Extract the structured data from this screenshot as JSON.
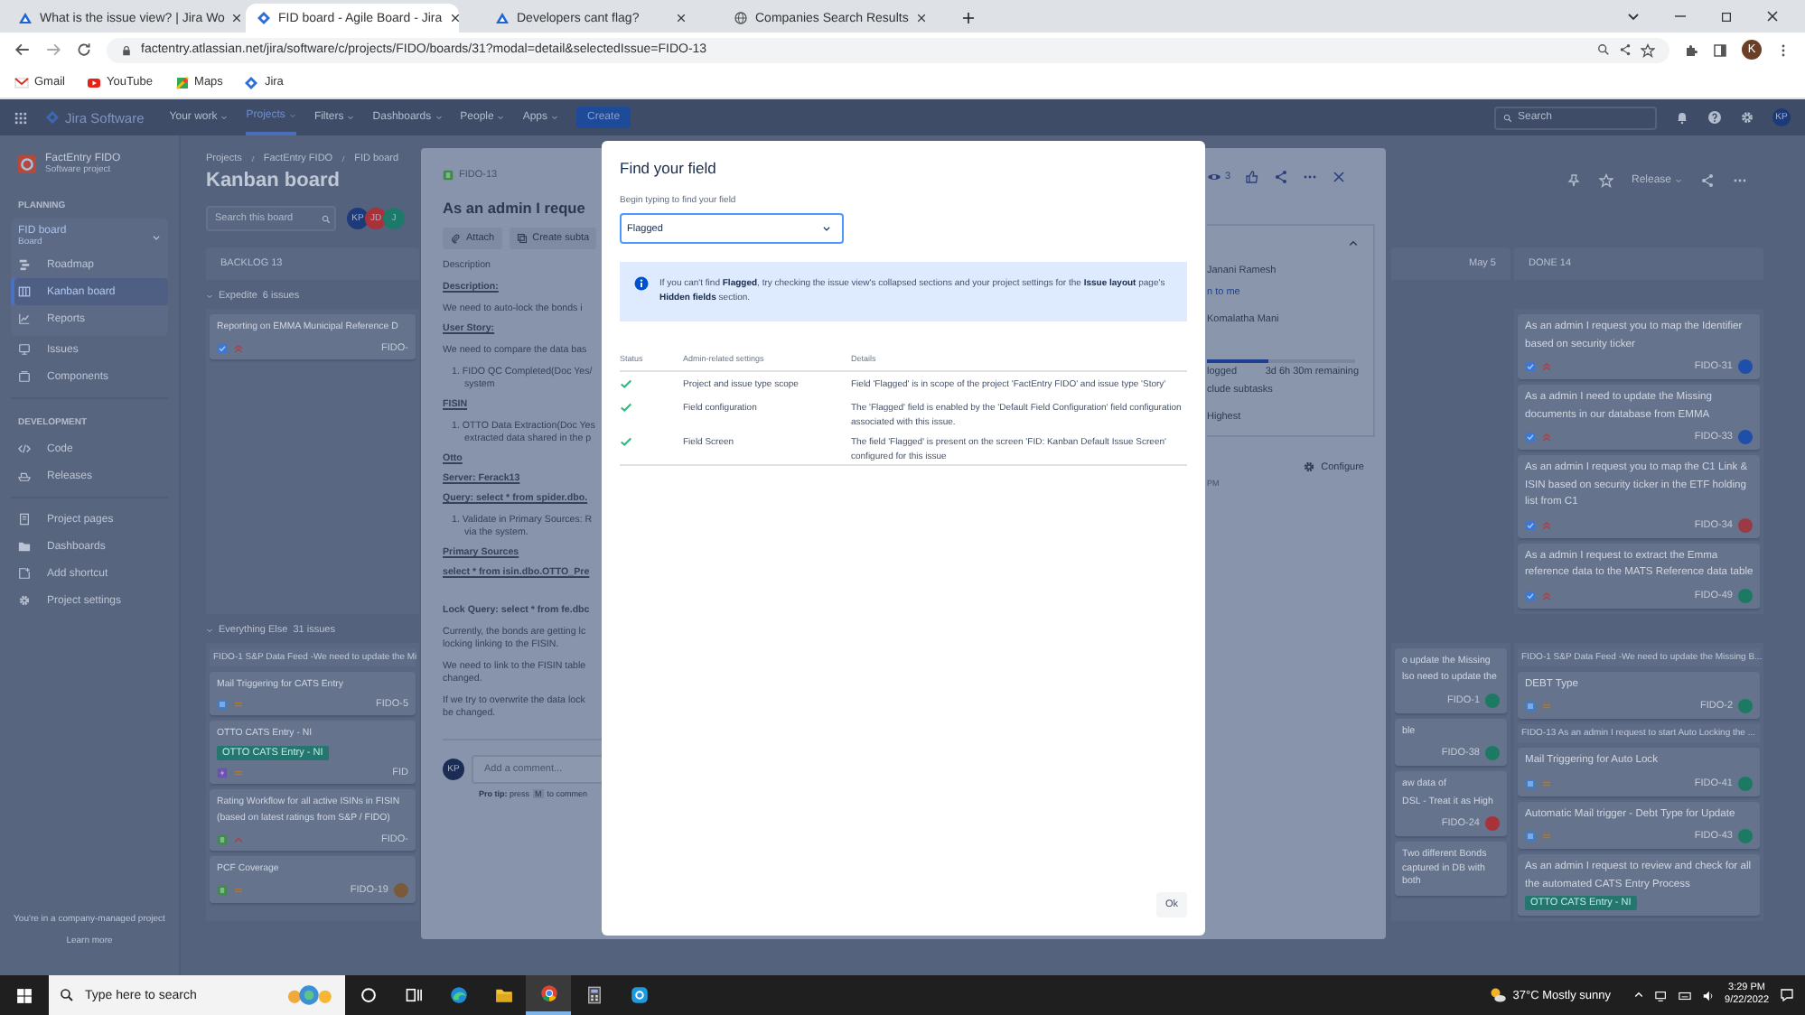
{
  "browser": {
    "tabs": [
      {
        "title": "What is the issue view? | Jira Wo",
        "kind": "triangle",
        "selected": false
      },
      {
        "title": "FID board - Agile Board - Jira",
        "kind": "diamond",
        "selected": true
      },
      {
        "title": "Developers cant flag?",
        "kind": "triangle",
        "selected": false
      },
      {
        "title": "Companies Search Results",
        "kind": "globe",
        "selected": false
      }
    ],
    "url": "factentry.atlassian.net/jira/software/c/projects/FIDO/boards/31?modal=detail&selectedIssue=FIDO-13",
    "profile": "K",
    "bookmarks": [
      {
        "label": "Gmail",
        "kind": "mail"
      },
      {
        "label": "YouTube",
        "kind": "play"
      },
      {
        "label": "Maps",
        "kind": "pin"
      },
      {
        "label": "Jira",
        "kind": "diamond"
      }
    ]
  },
  "jira_nav": {
    "product": "Jira Software",
    "items": [
      {
        "label": "Your work",
        "selected": false
      },
      {
        "label": "Projects",
        "selected": true
      },
      {
        "label": "Filters",
        "selected": false
      },
      {
        "label": "Dashboards",
        "selected": false
      },
      {
        "label": "People",
        "selected": false
      },
      {
        "label": "Apps",
        "selected": false
      }
    ],
    "create": "Create",
    "search": {
      "placeholder": "Search"
    },
    "avatar": "KP"
  },
  "sidebar": {
    "project": {
      "name": "FactEntry FIDO",
      "type": "Software project"
    },
    "groups": [
      {
        "heading": "PLANNING",
        "board": {
          "name": "FID board",
          "type": "Board"
        },
        "items": [
          {
            "label": "Roadmap",
            "kind": "roadmap",
            "selected": false
          },
          {
            "label": "Kanban board",
            "kind": "kanban",
            "selected": true
          },
          {
            "label": "Reports",
            "kind": "reports",
            "selected": false
          }
        ]
      },
      {
        "items": [
          {
            "label": "Issues",
            "kind": "issues",
            "selected": false
          },
          {
            "label": "Components",
            "kind": "components",
            "selected": false
          }
        ]
      },
      {
        "heading": "DEVELOPMENT",
        "items": [
          {
            "label": "Code",
            "kind": "code",
            "selected": false
          },
          {
            "label": "Releases",
            "kind": "releases",
            "selected": false
          }
        ]
      },
      {
        "items": [
          {
            "label": "Project pages",
            "kind": "pages",
            "selected": false
          },
          {
            "label": "Dashboards",
            "kind": "dashboards",
            "selected": false
          },
          {
            "label": "Add shortcut",
            "kind": "shortcut",
            "selected": false
          },
          {
            "label": "Project settings",
            "kind": "settings",
            "selected": false
          }
        ]
      }
    ],
    "note": "You're in a company-managed project",
    "link": "Learn more"
  },
  "board": {
    "breadcrumbs": [
      "Projects",
      "FactEntry FIDO",
      "FID board"
    ],
    "title": "Kanban board",
    "search": {
      "placeholder": "Search this board"
    },
    "avatars": [
      {
        "initials": "KP",
        "color": "#1d3b7a"
      },
      {
        "initials": "JD",
        "color": "#a8323a"
      },
      {
        "initials": "J",
        "color": "#1d7a6a"
      }
    ],
    "release": "Release",
    "column_headers": {
      "backlog": "BACKLOG 13",
      "column_2": "May 5",
      "done": "DONE 14"
    },
    "swimlanes": [
      {
        "title": "Expedite",
        "count": "6 issues",
        "backlog": [
          {
            "kind": "card",
            "lines": [
              "Reporting on EMMA Municipal Reference D"
            ],
            "type_icon": {
              "kind": "task"
            },
            "priority_icon": {
              "kind": "highest"
            },
            "key": "FIDO-"
          }
        ],
        "done": [
          {
            "kind": "card",
            "lines": [
              "As an admin I request you to map the Identifier",
              "based on security ticker"
            ],
            "type_icon": {
              "kind": "task"
            },
            "priority_icon": {
              "kind": "highest"
            },
            "key": "FIDO-31",
            "avatar": {
              "color": "#1f4fa8"
            }
          },
          {
            "kind": "card",
            "lines": [
              "As a admin I need to update the Missing",
              "documents in our database from EMMA"
            ],
            "type_icon": {
              "kind": "task"
            },
            "priority_icon": {
              "kind": "highest"
            },
            "key": "FIDO-33",
            "avatar": {
              "color": "#1f4fa8"
            }
          },
          {
            "kind": "card",
            "lines": [
              "As an admin I request you to map the C1 Link &",
              "ISIN based on security ticker in the ETF holding",
              "list from C1"
            ],
            "type_icon": {
              "kind": "task"
            },
            "priority_icon": {
              "kind": "highest"
            },
            "key": "FIDO-34",
            "avatar": {
              "color": "#9a3a45"
            }
          },
          {
            "kind": "card",
            "lines": [
              "As a admin I request to extract the Emma",
              "reference data to the MATS Reference data table"
            ],
            "type_icon": {
              "kind": "task"
            },
            "priority_icon": {
              "kind": "highest"
            },
            "key": "FIDO-49",
            "avatar": {
              "color": "#1d7a62"
            }
          }
        ]
      },
      {
        "title": "Everything Else",
        "count": "31 issues",
        "backlog": [
          {
            "kind": "parent",
            "text": "FIDO-1 S&P Data Feed -We need to update the Mi"
          },
          {
            "kind": "card",
            "lines": [
              "Mail Triggering for CATS Entry"
            ],
            "type_icon": {
              "kind": "subtask"
            },
            "priority_icon": {
              "kind": "medium"
            },
            "key": "FIDO-5"
          },
          {
            "kind": "card",
            "lines": [
              "OTTO CATS Entry - NI"
            ],
            "tag": "OTTO CATS Entry - NI",
            "type_icon": {
              "kind": "epic"
            },
            "priority_icon": {
              "kind": "medium"
            },
            "key": "FID"
          },
          {
            "kind": "card",
            "lines": [
              "Rating Workflow for all active ISINs in FISIN",
              "(based on latest ratings from S&P / FIDO)"
            ],
            "type_icon": {
              "kind": "story"
            },
            "priority_icon": {
              "kind": "high"
            },
            "key": "FIDO-"
          },
          {
            "kind": "card",
            "lines": [
              "PCF Coverage"
            ],
            "type_icon": {
              "kind": "story"
            },
            "priority_icon": {
              "kind": "medium"
            },
            "key": "FIDO-19",
            "avatar": {
              "color": "#7a5a3a"
            }
          }
        ],
        "column_2": [
          {
            "kind": "card",
            "lines": [
              "o update the Missing",
              "lso need to update the"
            ],
            "key": "FIDO-1",
            "avatar": {
              "color": "#1d7a62"
            }
          },
          {
            "kind": "card",
            "lines": [
              "ble"
            ],
            "key": "FIDO-38",
            "avatar": {
              "color": "#1d7a62"
            }
          },
          {
            "kind": "card",
            "lines": [
              "aw data of",
              "DSL - Treat it as High"
            ],
            "key": "FIDO-24",
            "avatar": {
              "color": "#a8323a"
            }
          },
          {
            "kind": "card",
            "lines": [
              "Two different Bonds captured in DB with both"
            ]
          }
        ],
        "done": [
          {
            "kind": "parent",
            "text": "FIDO-1 S&P Data Feed -We need to update the Missing B..."
          },
          {
            "kind": "card",
            "lines": [
              "DEBT Type"
            ],
            "type_icon": {
              "kind": "subtask"
            },
            "priority_icon": {
              "kind": "medium"
            },
            "key": "FIDO-2",
            "avatar": {
              "color": "#1d7a62"
            }
          },
          {
            "kind": "parent",
            "text": "FIDO-13 As an admin I request to start Auto Locking the ..."
          },
          {
            "kind": "card",
            "lines": [
              "Mail Triggering for Auto Lock"
            ],
            "type_icon": {
              "kind": "subtask"
            },
            "priority_icon": {
              "kind": "medium"
            },
            "key": "FIDO-41",
            "avatar": {
              "color": "#1d7a62"
            }
          },
          {
            "kind": "card",
            "lines": [
              "Automatic Mail trigger - Debt Type for Update"
            ],
            "type_icon": {
              "kind": "subtask"
            },
            "priority_icon": {
              "kind": "medium"
            },
            "key": "FIDO-43",
            "avatar": {
              "color": "#1d7a62"
            }
          },
          {
            "kind": "card",
            "lines": [
              "As an admin I request to review and check for all",
              "the automated CATS Entry Process"
            ],
            "tag": "OTTO CATS Entry - NI"
          }
        ]
      }
    ]
  },
  "issue_panel": {
    "key": "FIDO-13",
    "title": "As an admin I reque",
    "actions": [
      "Attach",
      "Create subta"
    ],
    "description": [
      {
        "kind": "label",
        "text": "Description"
      },
      {
        "kind": "heading",
        "text": "Description:"
      },
      {
        "kind": "text",
        "text": "We need to auto-lock the bonds i"
      },
      {
        "kind": "heading",
        "text": "User Story:"
      },
      {
        "kind": "text",
        "text": "We need to compare the data bas"
      },
      {
        "kind": "list",
        "text": "1. FIDO QC Completed(Doc Yes/"
      },
      {
        "kind": "cont",
        "text": "system"
      },
      {
        "kind": "heading",
        "text": "FISIN"
      },
      {
        "kind": "list",
        "text": "1. OTTO Data Extraction(Doc Yes"
      },
      {
        "kind": "cont",
        "text": "extracted data shared in the p"
      },
      {
        "kind": "heading",
        "text": "Otto"
      },
      {
        "kind": "heading",
        "text": "Server: Ferack13"
      },
      {
        "kind": "heading",
        "text": "Query: select * from spider.dbo."
      },
      {
        "kind": "list",
        "text": "1. Validate in Primary Sources: R"
      },
      {
        "kind": "cont",
        "text": "via the system."
      },
      {
        "kind": "heading",
        "text": "Primary Sources"
      },
      {
        "kind": "heading",
        "text": "select * from isin.dbo.OTTO_Pre"
      },
      {
        "kind": "bold",
        "text": "Lock Query: select * from fe.dbc"
      },
      {
        "kind": "text",
        "text": "Currently, the bonds are getting lc"
      },
      {
        "kind": "cont",
        "text": "locking linking to the FISIN."
      },
      {
        "kind": "text",
        "text": "We need to link to the FISIN table"
      },
      {
        "kind": "cont",
        "text": "changed."
      },
      {
        "kind": "text",
        "text": "If we try to overwrite the data lock"
      },
      {
        "kind": "cont",
        "text": "be changed."
      }
    ],
    "comment": {
      "avatar": "KP",
      "placeholder": "Add a comment...",
      "tip": "**Pro tip:** press",
      "tip_key": "M",
      "tip_end": "to commen"
    },
    "watchers": "3",
    "details": {
      "assignee": "Janani Ramesh",
      "assign_link": "n to me",
      "reporter": "Komalatha Mani",
      "level": 0.42,
      "logged": "logged",
      "remaining": "3d 6h 30m remaining",
      "subtasks": "clude subtasks",
      "priority": "Highest"
    },
    "configure": "Configure",
    "time_fragment": "PM"
  },
  "modal": {
    "title": "Find your field",
    "field_label": "Begin typing to find your field",
    "field_value": "Flagged",
    "info": "If you can't find **Flagged**, try checking the issue view's collapsed sections and your project settings for the **Issue layout** page's **Hidden fields** section.",
    "columns": [
      "Status",
      "Admin-related settings",
      "Details"
    ],
    "rows": [
      {
        "kind": "pass",
        "setting": "Project and issue type scope",
        "details": "Field 'Flagged' is in scope of the project 'FactEntry FIDO' and issue type 'Story'"
      },
      {
        "kind": "pass",
        "setting": "Field configuration",
        "details": "The 'Flagged' field is enabled by the 'Default Field Configuration' field configuration associated with this issue."
      },
      {
        "kind": "pass",
        "setting": "Field Screen",
        "details": "The field 'Flagged' is present on the screen 'FID: Kanban Default Issue Screen' configured for this issue"
      }
    ],
    "ok": "Ok"
  },
  "taskbar": {
    "search_placeholder": "Type here to search",
    "apps": [
      {
        "kind": "cortana",
        "active": false
      },
      {
        "kind": "taskview",
        "active": false
      },
      {
        "kind": "edge",
        "active": false
      },
      {
        "kind": "explorer",
        "active": false
      },
      {
        "kind": "chrome",
        "active": true
      },
      {
        "kind": "calculator",
        "active": false
      },
      {
        "kind": "skype",
        "active": false
      }
    ],
    "weather": "37°C  Mostly sunny",
    "time": "3:29 PM",
    "date": "9/22/2022"
  }
}
